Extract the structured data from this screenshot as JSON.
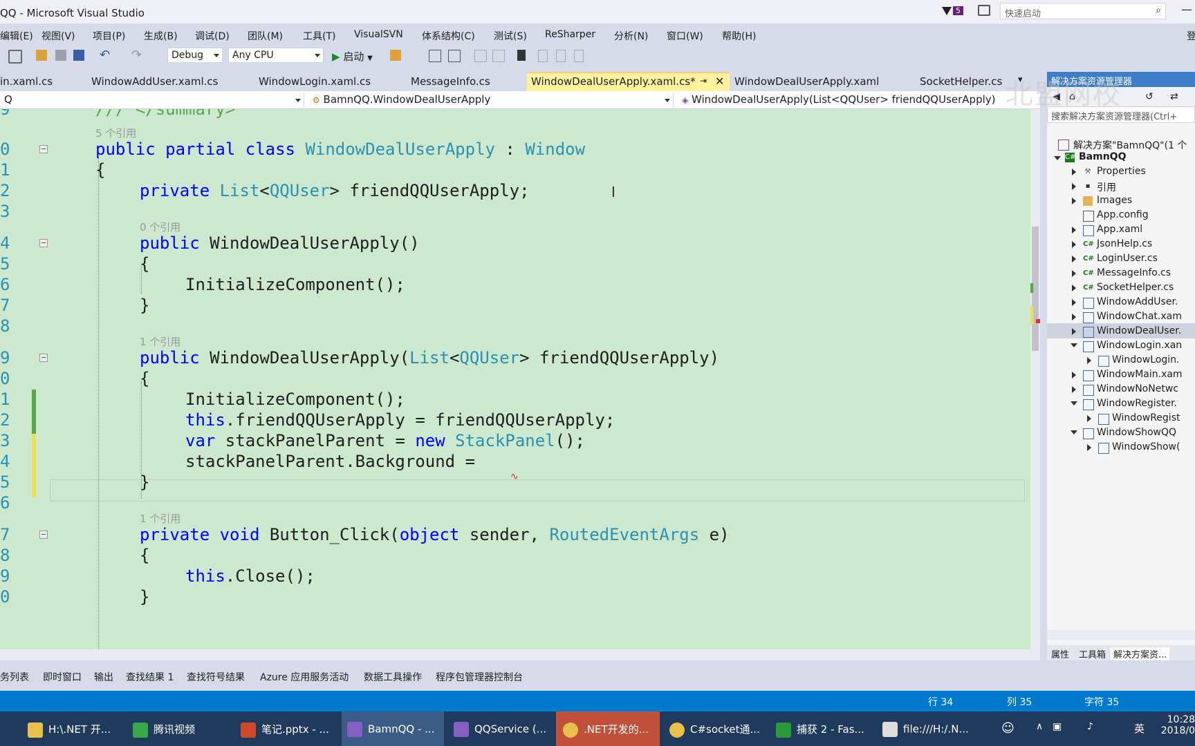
{
  "window": {
    "title": "QQ - Microsoft Visual Studio"
  },
  "notifications": {
    "count": "5"
  },
  "quick_launch": {
    "placeholder": "快速启动"
  },
  "menu": [
    "编辑(E)",
    "视图(V)",
    "项目(P)",
    "生成(B)",
    "调试(D)",
    "团队(M)",
    "工具(T)",
    "VisualSVN",
    "体系结构(C)",
    "测试(S)",
    "ReSharper",
    "分析(N)",
    "窗口(W)",
    "帮助(H)"
  ],
  "menu_right": "登",
  "toolbar": {
    "config": "Debug",
    "platform": "Any CPU",
    "start_label": "启动"
  },
  "tabs": [
    {
      "label": "in.xaml.cs"
    },
    {
      "label": "WindowAddUser.xaml.cs"
    },
    {
      "label": "WindowLogin.xaml.cs"
    },
    {
      "label": "MessageInfo.cs"
    },
    {
      "label": "WindowDealUserApply.xaml.cs*"
    },
    {
      "label": "WindowDealUserApply.xaml"
    },
    {
      "label": "SocketHelper.cs"
    }
  ],
  "navbar": {
    "project": "Q",
    "type": "BamnQQ.WindowDealUserApply",
    "member": "WindowDealUserApply(List<QQUser> friendQQUserApply)"
  },
  "editor": {
    "line_numbers": [
      "9",
      "0",
      "1",
      "2",
      "3",
      "4",
      "5",
      "6",
      "7",
      "8",
      "9",
      "0",
      "1",
      "2",
      "3",
      "4",
      "5",
      "6",
      "7",
      "8",
      "9",
      "0"
    ],
    "refs": {
      "r5": "5 个引用",
      "r0": "0 个引用",
      "r1a": "1 个引用",
      "r1b": "1 个引用"
    },
    "code": {
      "l0": "/// </summary>",
      "l1_kw": "public partial class ",
      "l1_ty": "WindowDealUserApply",
      "l1_sep": " : ",
      "l1_base": "Window",
      "l2": "{",
      "l3_kw": "private ",
      "l3_ty1": "List",
      "l3_p1": "<",
      "l3_ty2": "QQUser",
      "l3_p2": "> friendQQUserApply;",
      "l4": "",
      "l5_kw": "public ",
      "l5_rest": "WindowDealUserApply()",
      "l6": "{",
      "l7": "InitializeComponent();",
      "l8": "}",
      "l9": "",
      "l10_kw": "public ",
      "l10_n": "WindowDealUserApply(",
      "l10_ty1": "List",
      "l10_p1": "<",
      "l10_ty2": "QQUser",
      "l10_p2": "> friendQQUserApply)",
      "l11": "{",
      "l12": "InitializeComponent();",
      "l13_kw": "this",
      "l13_rest": ".friendQQUserApply = friendQQUserApply;",
      "l14_kw": "var",
      "l14_m": " stackPanelParent = ",
      "l14_kw2": "new",
      "l14_sp": " ",
      "l14_ty": "StackPanel",
      "l14_end": "();",
      "l15": "stackPanelParent.Background =",
      "l16": "}",
      "l17": "",
      "l18_kw": "private void ",
      "l18_n": "Button_Click(",
      "l18_kw2": "object",
      "l18_m": " sender, ",
      "l18_ty": "RoutedEventArgs",
      "l18_end": " e)",
      "l19": "{",
      "l20_kw": "this",
      "l20_rest": ".Close();",
      "l21": "}"
    }
  },
  "solution_explorer": {
    "title": "解决方案资源管理器",
    "search_placeholder": "搜索解决方案资源管理器(Ctrl+",
    "solution": "解决方案\"BamnQQ\"(1 个",
    "project": "BamnQQ",
    "items": [
      "Properties",
      "引用",
      "Images",
      "App.config",
      "App.xaml",
      "JsonHelp.cs",
      "LoginUser.cs",
      "MessageInfo.cs",
      "SocketHelper.cs",
      "WindowAddUser.",
      "WindowChat.xam",
      "WindowDealUser.",
      "WindowLogin.xan",
      "WindowLogin.",
      "WindowMain.xam",
      "WindowNoNetwc",
      "WindowRegister.",
      "WindowRegist",
      "WindowShowQQ",
      "WindowShow("
    ],
    "bottom_tabs": [
      "属性",
      "工具箱",
      "解决方案资..."
    ]
  },
  "output_tabs": [
    "务列表",
    "即时窗口",
    "输出",
    "查找结果 1",
    "查找符号结果",
    "Azure 应用服务活动",
    "数据工具操作",
    "程序包管理器控制台"
  ],
  "status": {
    "line": "行 34",
    "col": "列 35",
    "ch": "字符 35"
  },
  "taskbar": {
    "items": [
      "H:\\.NET 开...",
      "腾讯视频",
      "笔记.pptx - ...",
      "BamnQQ - ...",
      "QQService (...",
      ".NET开发的...",
      "C#socket通...",
      "捕获 2 - Fas...",
      "file:///H:/.N..."
    ],
    "ime": "英",
    "time": "10:28",
    "date": "2018/0"
  },
  "watermark": "北盟网校",
  "colors": {
    "keyword": "#0000ff",
    "type": "#2b91af",
    "comment": "#57a64a",
    "editor_bg": "#cce8cf",
    "statusbar": "#007acc",
    "active_tab": "#fff29d"
  }
}
